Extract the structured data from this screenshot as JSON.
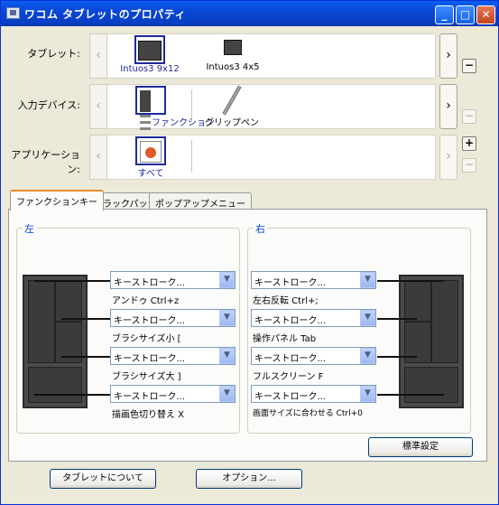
{
  "window": {
    "title": "ワコム タブレットのプロパティ"
  },
  "rows": {
    "tablet_label": "タブレット:",
    "device_label": "入力デバイス:",
    "app_label": "アプリケーション:",
    "tablets": [
      "Intuos3 9x12",
      "Intuos3 4x5"
    ],
    "devices": [
      "ファンクション",
      "グリップペン"
    ],
    "apps": [
      "すべて"
    ]
  },
  "tabs": [
    "ファンクションキー",
    "トラックパッド",
    "ポップアップメニュー"
  ],
  "left": {
    "title": "左",
    "combo": "キーストローク...",
    "descs": [
      "アンドゥ  Ctrl+z",
      "ブラシサイズ小  [",
      "ブラシサイズ大  ]",
      "描画色切り替え  X"
    ]
  },
  "right": {
    "title": "右",
    "combo": "キーストローク...",
    "descs": [
      "左右反転  Ctrl+;",
      "操作パネル  Tab",
      "フルスクリーン  F",
      "画面サイズに合わせる  Ctrl+0"
    ]
  },
  "buttons": {
    "default": "標準設定",
    "about": "タブレットについて",
    "options": "オプション..."
  },
  "glyphs": {
    "left": "‹",
    "right": "›",
    "plus": "+",
    "minus": "−",
    "dropdown": "▼",
    "minimize": "_",
    "maximize": "□",
    "close": "✕"
  }
}
